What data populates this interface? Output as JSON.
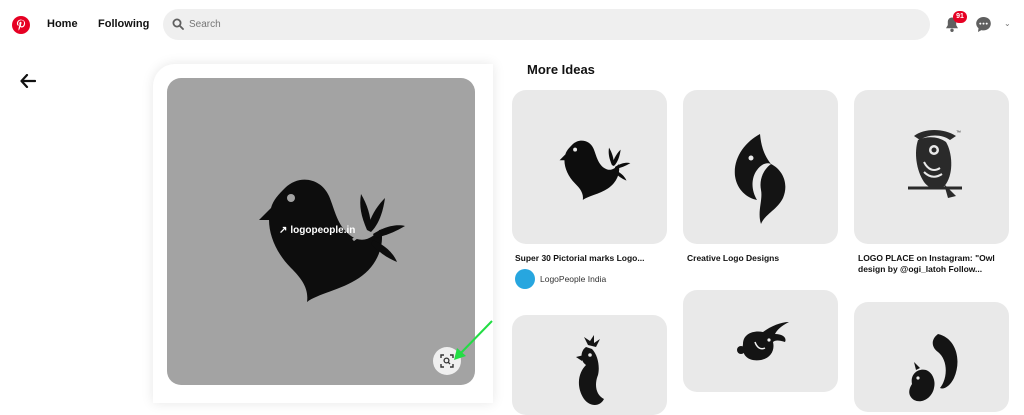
{
  "header": {
    "nav": {
      "home": "Home",
      "following": "Following"
    },
    "search": {
      "placeholder": "Search"
    },
    "notifications": {
      "count": "91"
    }
  },
  "pin": {
    "link_label": "logopeople.in"
  },
  "more_ideas": {
    "title": "More Ideas",
    "items": [
      {
        "title": "Super 30 Pictorial marks Logo...",
        "source": "LogoPeople India"
      },
      {
        "title": "Creative Logo Designs"
      },
      {
        "title": "LOGO PLACE on Instagram: \"Owl design by @ogi_latoh Follow..."
      }
    ]
  },
  "colors": {
    "brand": "#e60023",
    "image_bg": "#a3a3a3",
    "annotation": "#22dd44"
  },
  "icons": [
    "pinterest-logo",
    "search-icon",
    "bell-icon",
    "chat-icon",
    "chevron-down-icon",
    "back-arrow-icon",
    "visual-search-icon"
  ]
}
